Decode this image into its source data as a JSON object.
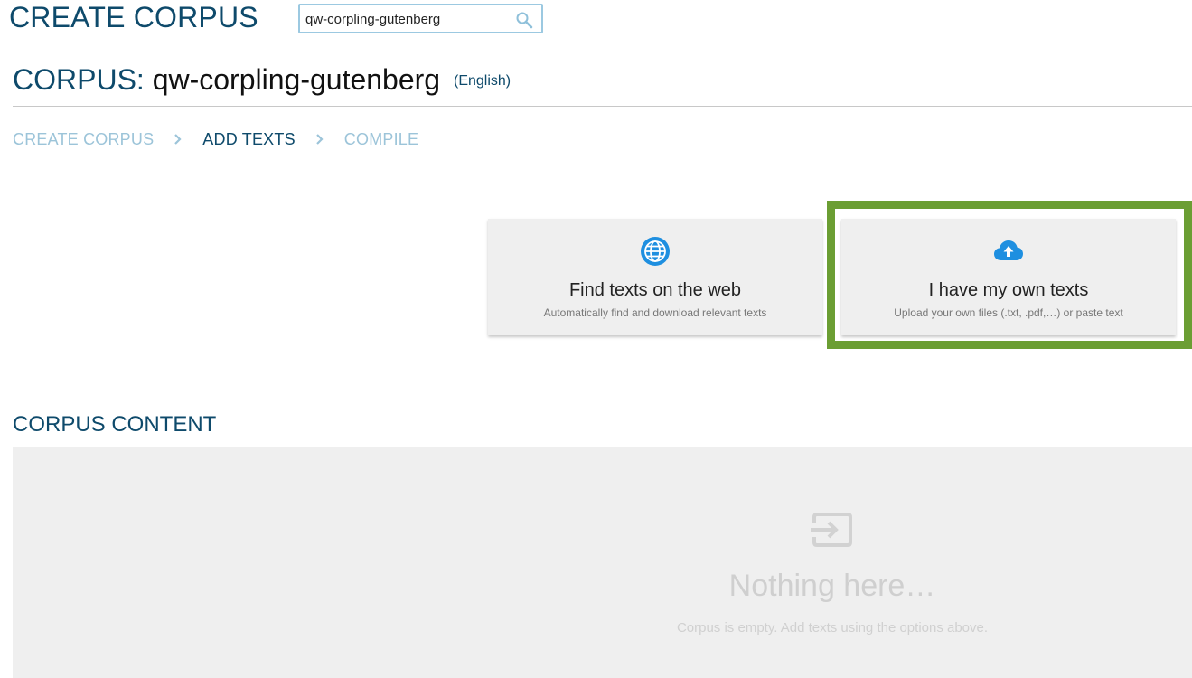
{
  "header": {
    "app_title": "CREATE CORPUS",
    "search": {
      "value": "qw-corpling-gutenberg",
      "icon": "search-icon"
    }
  },
  "corpus": {
    "prefix": "CORPUS:",
    "name": "qw-corpling-gutenberg",
    "language": "(English)"
  },
  "steps": [
    {
      "label": "CREATE CORPUS",
      "state": "done"
    },
    {
      "label": "ADD TEXTS",
      "state": "current"
    },
    {
      "label": "COMPILE",
      "state": "upcoming"
    }
  ],
  "options": {
    "web": {
      "icon": "globe-icon",
      "title": "Find texts on the web",
      "subtitle": "Automatically find and download relevant texts"
    },
    "own": {
      "icon": "cloud-upload-icon",
      "title": "I have my own texts",
      "subtitle": "Upload your own files (.txt, .pdf,…) or paste text",
      "highlighted": true
    }
  },
  "corpus_content": {
    "heading": "CORPUS CONTENT",
    "empty_icon": "input-arrow-icon",
    "empty_title": "Nothing here…",
    "empty_subtitle": "Corpus is empty. Add texts using the options above."
  },
  "colors": {
    "brand": "#0e4a6b",
    "step_inactive": "#9cc4d9",
    "highlight": "#6b9e33",
    "icon_blue": "#1e8fe0"
  }
}
